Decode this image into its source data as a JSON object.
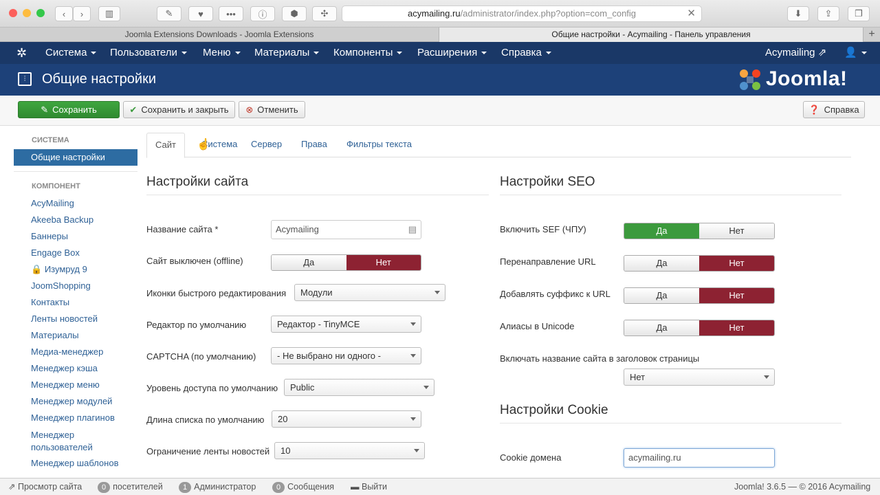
{
  "browser": {
    "url_host": "acymailing.ru",
    "url_path": "/administrator/index.php?option=com_config",
    "tabs": [
      {
        "label": "Joomla Extensions Downloads - Joomla Extensions"
      },
      {
        "label": "Общие настройки - Acymailing - Панель управления"
      }
    ]
  },
  "nav": {
    "items": [
      "Система",
      "Пользователи",
      "Меню",
      "Материалы",
      "Компоненты",
      "Расширения",
      "Справка"
    ],
    "site_link": "Acymailing"
  },
  "header": {
    "title": "Общие настройки",
    "logo_text": "Joomla!"
  },
  "toolbar": {
    "save": "Сохранить",
    "save_close": "Сохранить и закрыть",
    "cancel": "Отменить",
    "help": "Справка"
  },
  "sidebar": {
    "system_heading": "СИСТЕМА",
    "active_item": "Общие настройки",
    "component_heading": "КОМПОНЕНТ",
    "items": [
      "AcyMailing",
      "Akeeba Backup",
      "Баннеры",
      "Engage Box",
      "Изумруд 9",
      "JoomShopping",
      "Контакты",
      "Ленты новостей",
      "Материалы",
      "Медиа-менеджер",
      "Менеджер кэша",
      "Менеджер меню",
      "Менеджер модулей",
      "Менеджер плагинов",
      "Менеджер пользователей",
      "Менеджер шаблонов"
    ]
  },
  "content_tabs": [
    "Сайт",
    "Система",
    "Сервер",
    "Права",
    "Фильтры текста"
  ],
  "site_settings": {
    "title": "Настройки сайта",
    "site_name_label": "Название сайта *",
    "site_name_value": "Acymailing",
    "offline_label": "Сайт выключен (offline)",
    "yes": "Да",
    "no": "Нет",
    "quick_icons_label": "Иконки быстрого редактирования",
    "quick_icons_value": "Модули",
    "editor_label": "Редактор по умолчанию",
    "editor_value": "Редактор - TinyMCE",
    "captcha_label": "CAPTCHA (по умолчанию)",
    "captcha_value": "- Не выбрано ни одного -",
    "access_label": "Уровень доступа по умолчанию",
    "access_value": "Public",
    "list_label": "Длина списка по умолчанию",
    "list_value": "20",
    "feed_label": "Ограничение ленты новостей",
    "feed_value": "10"
  },
  "seo_settings": {
    "title": "Настройки SEO",
    "sef_label": "Включить SEF (ЧПУ)",
    "rewrite_label": "Перенаправление URL",
    "suffix_label": "Добавлять суффикс к URL",
    "unicode_label": "Алиасы в Unicode",
    "sitename_label": "Включать название сайта в заголовок страницы",
    "sitename_value": "Нет"
  },
  "cookie_settings": {
    "title": "Настройки Cookie",
    "domain_label": "Cookie домена",
    "domain_value": "acymailing.ru"
  },
  "status": {
    "view_site": "Просмотр сайта",
    "visitors_count": "0",
    "visitors_label": "посетителей",
    "admin_count": "1",
    "admin_label": "Администратор",
    "messages_count": "0",
    "messages_label": "Сообщения",
    "logout": "Выйти",
    "version": "Joomla! 3.6.5",
    "dash": "—",
    "copyright": "© 2016 Acymailing"
  }
}
